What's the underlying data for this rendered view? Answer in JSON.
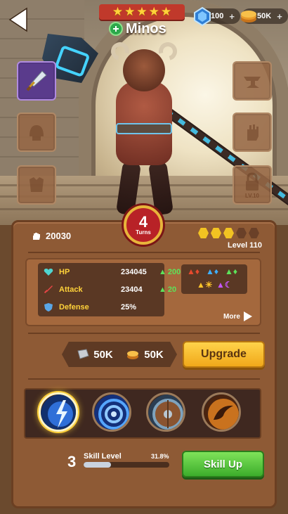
{
  "header": {
    "star_count": 5,
    "hero_name": "Minos",
    "gems": {
      "value": "100",
      "plus": "+"
    },
    "gold": {
      "value": "50K",
      "plus": "+"
    }
  },
  "equipment": {
    "left": [
      "weapon-slot-equipped",
      "helmet-slot",
      "armor-slot"
    ],
    "right": [
      "anvil-slot",
      "gloves-slot",
      "locked-slot"
    ],
    "locked_level": "LV.10"
  },
  "turns": {
    "number": "4",
    "label": "Turns"
  },
  "power": {
    "value": "20030"
  },
  "level": {
    "label": "Level 110",
    "filled_hexes": 3,
    "total_hexes": 5
  },
  "stats": [
    {
      "label": "HP",
      "value": "234045",
      "bonus": "200",
      "icon": "heart-icon",
      "color": "#4fd5d0"
    },
    {
      "label": "Attack",
      "value": "23404",
      "bonus": "20",
      "icon": "sword-icon",
      "color": "#e64545"
    },
    {
      "label": "Defense",
      "value": "25%",
      "bonus": "",
      "icon": "shield-icon",
      "color": "#5aa6e6"
    }
  ],
  "elements_icons": [
    "fire-up-icon",
    "water-up-icon",
    "leaf-up-icon",
    "sun-icon",
    "moon-icon"
  ],
  "more_label": "More",
  "cost": {
    "ingot": "50K",
    "gold": "50K"
  },
  "upgrade_label": "Upgrade",
  "skills": [
    "lightning-skill-icon",
    "vortex-skill-icon",
    "shield-skill-icon",
    "claw-skill-icon"
  ],
  "skill_level": {
    "number": "3",
    "label": "Skill Level",
    "percent": "31.8%",
    "progress": 0.318
  },
  "skill_up_label": "Skill Up"
}
